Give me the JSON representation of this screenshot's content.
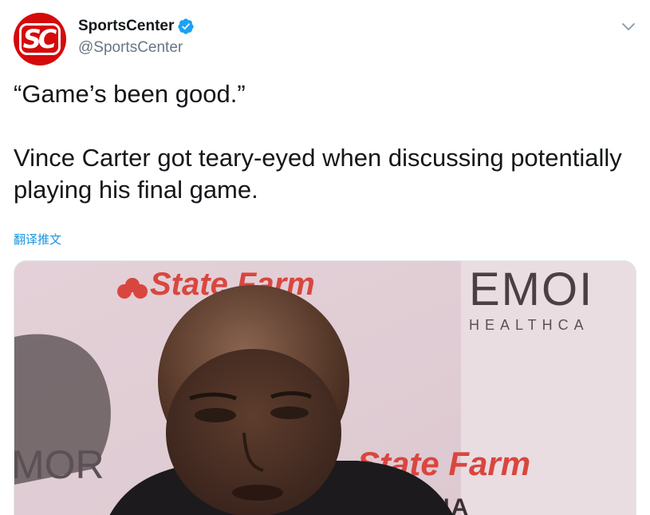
{
  "account": {
    "display_name": "SportsCenter",
    "handle": "@SportsCenter",
    "avatar_text": "SC",
    "verified": true,
    "avatar_color": "#d50a0a"
  },
  "tweet": {
    "quote": "“Game’s been good.”",
    "body": "Vince Carter got teary-eyed when discussing potentially playing his final game."
  },
  "translate_label": "翻译推文",
  "media": {
    "type": "video-thumbnail",
    "backdrop_text": {
      "sponsor_top": "State Farm",
      "sponsor_bottom": "State Farm",
      "emory_top": "EMOI",
      "emory_sub": "HEALTHCA",
      "emory_left": "MOR",
      "arena_fragment": "ENA"
    }
  },
  "colors": {
    "link": "#1b95e0",
    "verified": "#1da1f2",
    "secondary_text": "#657786"
  },
  "icons": [
    "verified-badge-icon",
    "chevron-down-icon"
  ]
}
